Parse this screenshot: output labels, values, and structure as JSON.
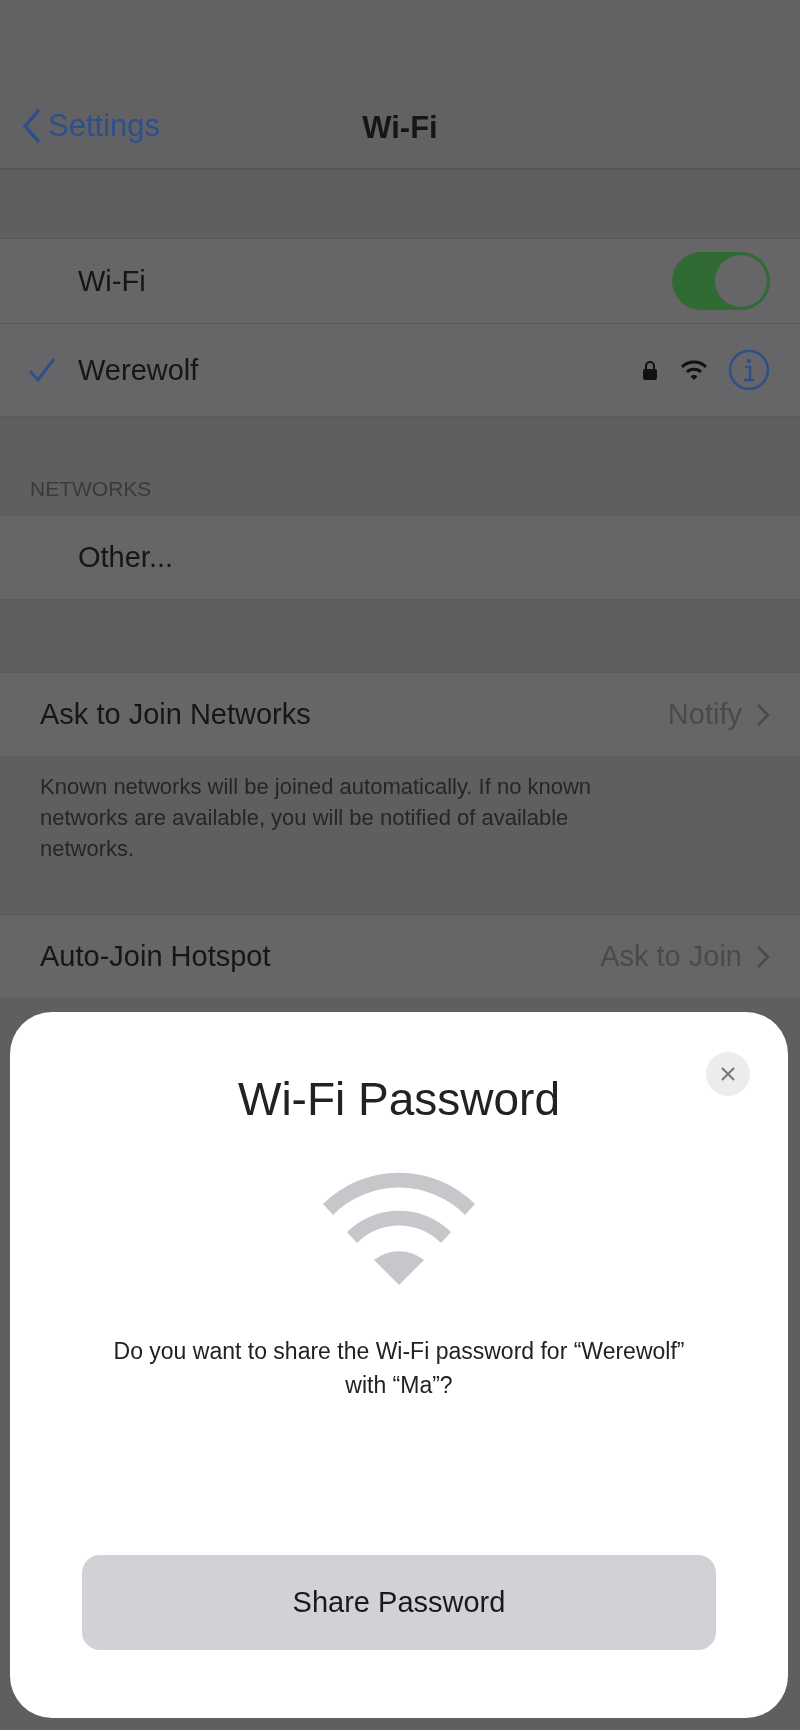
{
  "nav": {
    "back": "Settings",
    "title": "Wi-Fi"
  },
  "wifi_rows": [
    {
      "kind": "toggle",
      "label": "Wi-Fi",
      "on": true
    },
    {
      "kind": "network",
      "label": "Werewolf",
      "selected": true,
      "locked": true
    }
  ],
  "networks_header": "NETWORKS",
  "networks": [
    {
      "label": "Other..."
    }
  ],
  "settings": [
    {
      "label": "Ask to Join Networks",
      "value": "Notify",
      "footer": "Known networks will be joined automatically. If no known networks are available, you will be notified of available networks."
    },
    {
      "label": "Auto-Join Hotspot",
      "value": "Ask to Join"
    }
  ],
  "sheet": {
    "title": "Wi-Fi Password",
    "message": "Do you want to share the Wi-Fi password for “Werewolf” with “Ma”?",
    "button": "Share Password"
  }
}
